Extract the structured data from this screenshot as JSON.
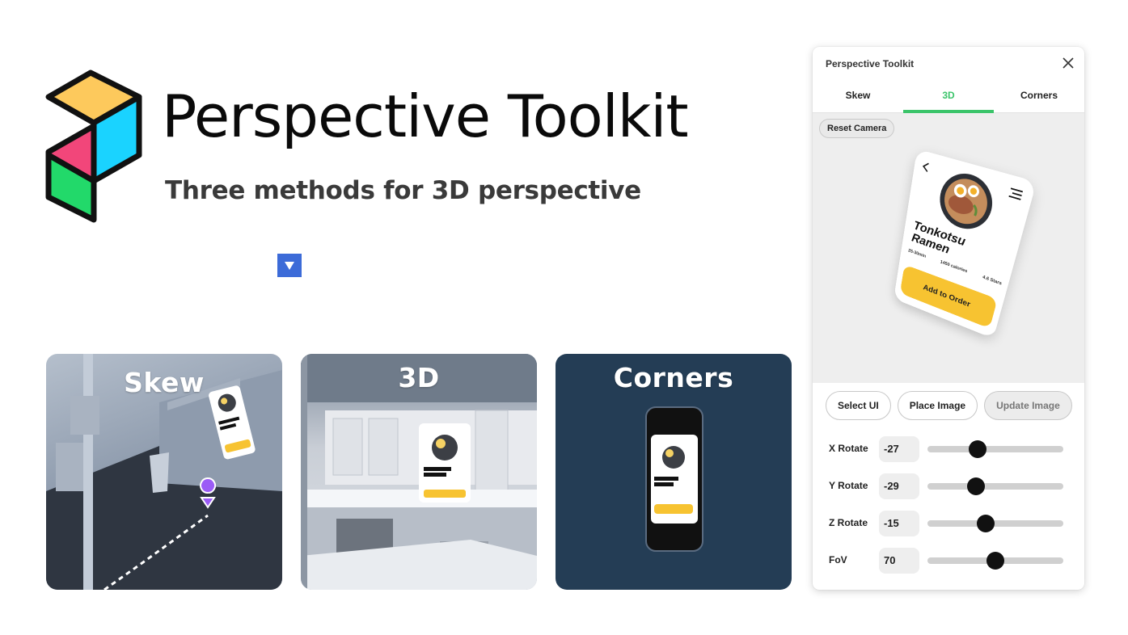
{
  "hero": {
    "title": "Perspective Toolkit",
    "subtitle": "Three methods for 3D perspective",
    "logo_colors": [
      "#fdc95c",
      "#1ad3ff",
      "#f2467a",
      "#22d96a"
    ]
  },
  "dropdown": {
    "icon": "triangle-down-icon",
    "color": "#3c6bd8"
  },
  "cards": [
    {
      "label": "Skew"
    },
    {
      "label": "3D"
    },
    {
      "label": "Corners"
    }
  ],
  "mockup": {
    "title_line1": "Tonkotsu",
    "title_line2": "Ramen",
    "time": "25-30min",
    "calories": "1450 calories",
    "stars": "4.6 Stars",
    "order_label": "Add to Order"
  },
  "panel": {
    "title": "Perspective Toolkit",
    "tabs": [
      {
        "label": "Skew",
        "active": false
      },
      {
        "label": "3D",
        "active": true
      },
      {
        "label": "Corners",
        "active": false
      }
    ],
    "accent": "#3bc46a",
    "reset_label": "Reset Camera",
    "actions": [
      {
        "label": "Select UI",
        "disabled": false
      },
      {
        "label": "Place Image",
        "disabled": false
      },
      {
        "label": "Update Image",
        "disabled": true
      }
    ],
    "sliders": [
      {
        "label": "X Rotate",
        "value": "-27",
        "fraction": 0.37
      },
      {
        "label": "Y Rotate",
        "value": "-29",
        "fraction": 0.36
      },
      {
        "label": "Z Rotate",
        "value": "-15",
        "fraction": 0.43
      },
      {
        "label": "FoV",
        "value": "70",
        "fraction": 0.5
      }
    ]
  }
}
